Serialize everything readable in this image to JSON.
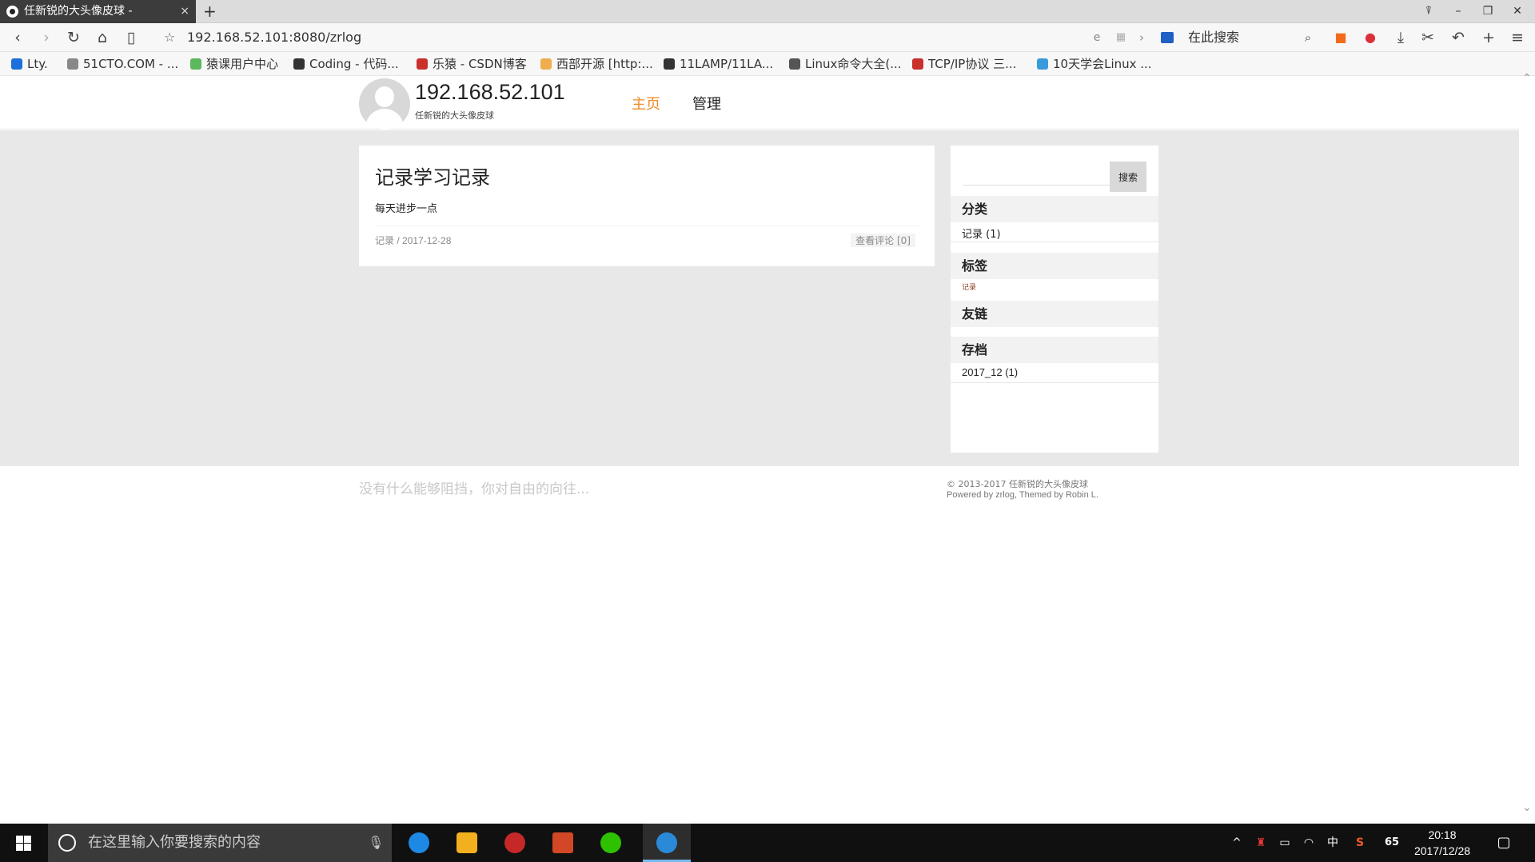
{
  "browser": {
    "tab_title": "任新锐的大头像皮球 -",
    "tab_close": "×",
    "new_tab": "+",
    "url": "192.168.52.101:8080/zrlog",
    "search_placeholder": "在此搜索",
    "win_controls": {
      "pin": "⍒",
      "minimize": "–",
      "restore": "❐",
      "close": "✕"
    }
  },
  "bookmarks": [
    {
      "label": "Lty.",
      "color": "#1e6fd9"
    },
    {
      "label": "51CTO.COM - ...",
      "color": "#888888"
    },
    {
      "label": "猿课用户中心",
      "color": "#5cb85c"
    },
    {
      "label": "Coding - 代码...",
      "color": "#333333"
    },
    {
      "label": "乐猿 - CSDN博客",
      "color": "#c9302c"
    },
    {
      "label": "西部开源 [http:...",
      "color": "#f0ad4e"
    },
    {
      "label": "11LAMP/11LA...",
      "color": "#333333"
    },
    {
      "label": "Linux命令大全(...",
      "color": "#555555"
    },
    {
      "label": "TCP/IP协议 三...",
      "color": "#c9302c"
    },
    {
      "label": "10天学会Linux ...",
      "color": "#3a9bdc"
    }
  ],
  "site": {
    "title": "192.168.52.101",
    "subtitle": "任新锐的大头像皮球",
    "nav": {
      "home": "主页",
      "admin": "管理"
    },
    "accent_color": "#f08a24"
  },
  "post": {
    "title": "记录学习记录",
    "body": "每天进步一点",
    "meta": "记录 / 2017-12-28",
    "comments": "查看评论 [0]"
  },
  "sidebar": {
    "search_button": "搜索",
    "categories": {
      "heading": "分类",
      "items": [
        "记录 (1)"
      ]
    },
    "tags": {
      "heading": "标签",
      "items": [
        "记录"
      ]
    },
    "links": {
      "heading": "友链",
      "items": []
    },
    "archives": {
      "heading": "存档",
      "items": [
        "2017_12 (1)"
      ]
    }
  },
  "footer": {
    "slogan": "没有什么能够阻挡，你对自由的向往...",
    "copyright": "© 2013-2017 任新锐的大头像皮球",
    "powered": "Powered by zrlog, Themed by Robin L."
  },
  "taskbar": {
    "search_placeholder": "在这里输入你要搜索的内容",
    "ime": "中",
    "badge": "65",
    "time": "20:18",
    "date": "2017/12/28"
  }
}
